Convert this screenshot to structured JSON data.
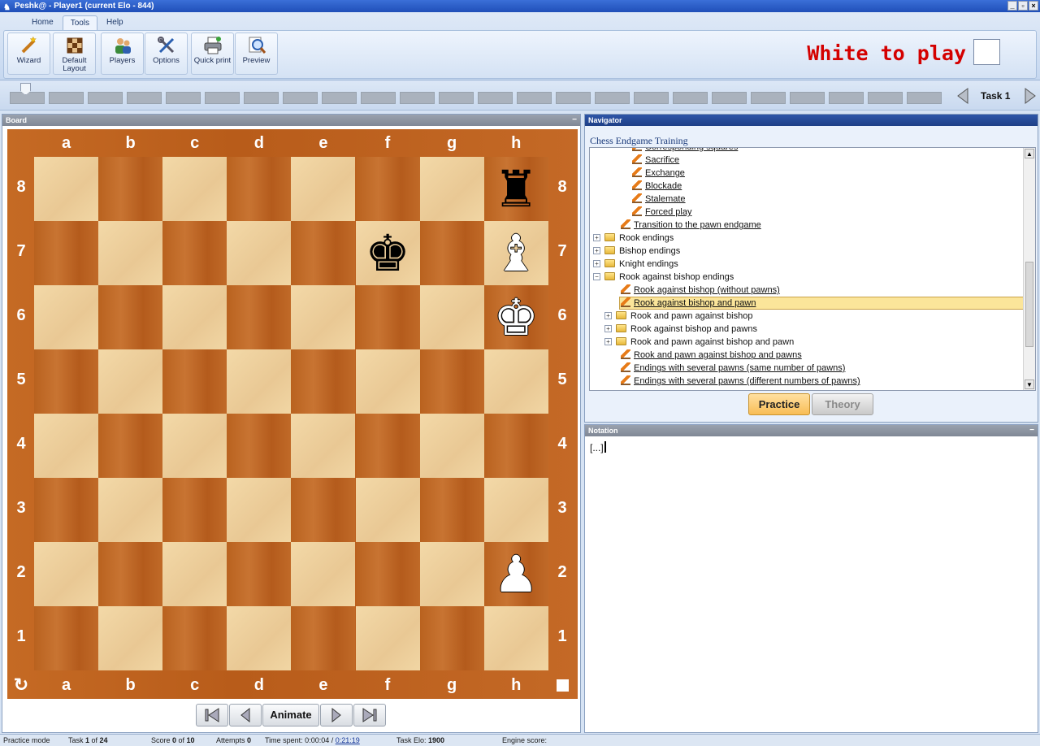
{
  "window": {
    "title": "Peshk@ - Player1 (current Elo - 844)"
  },
  "ribbon": {
    "tabs": [
      {
        "label": "Home"
      },
      {
        "label": "Tools"
      },
      {
        "label": "Help"
      }
    ],
    "buttons": {
      "wizard": "Wizard",
      "default_layout_1": "Default",
      "default_layout_2": "Layout",
      "players": "Players",
      "options": "Options",
      "quick_print": "Quick print",
      "preview": "Preview"
    },
    "turn_label": "White to play"
  },
  "task_strip": {
    "task_label": "Task  1"
  },
  "board": {
    "panel_title": "Board",
    "files": [
      "a",
      "b",
      "c",
      "d",
      "e",
      "f",
      "g",
      "h"
    ],
    "ranks": [
      "8",
      "7",
      "6",
      "5",
      "4",
      "3",
      "2",
      "1"
    ],
    "pieces": {
      "h8": "♜",
      "f7": "♚",
      "h7": "♝",
      "h6": "♚",
      "h2": "♟"
    },
    "flip_glyph": "↻",
    "animate_label": "Animate"
  },
  "navigator": {
    "panel_title": "Navigator",
    "course_title": "Chess Endgame Training",
    "items": [
      {
        "label": "Corresponding squares"
      },
      {
        "label": "Sacrifice"
      },
      {
        "label": "Exchange"
      },
      {
        "label": "Blockade"
      },
      {
        "label": "Stalemate"
      },
      {
        "label": "Forced play"
      },
      {
        "label": "Transition to the pawn endgame"
      },
      {
        "label": "Rook endings"
      },
      {
        "label": "Bishop endings"
      },
      {
        "label": "Knight endings"
      },
      {
        "label": "Rook against bishop endings"
      },
      {
        "label": "Rook against bishop (without pawns)"
      },
      {
        "label": "Rook against bishop and pawn"
      },
      {
        "label": "Rook and pawn against bishop"
      },
      {
        "label": "Rook against bishop and pawns"
      },
      {
        "label": "Rook and pawn against bishop and pawn"
      },
      {
        "label": "Rook and pawn against bishop and pawns"
      },
      {
        "label": "Endings with several pawns (same number of pawns)"
      },
      {
        "label": "Endings with several pawns (different numbers of pawns)"
      }
    ],
    "practice_label": "Practice",
    "theory_label": "Theory"
  },
  "notation": {
    "panel_title": "Notation",
    "text": "[...]"
  },
  "status": {
    "mode": "Practice mode",
    "task_prefix": "Task ",
    "task_num": "1",
    "task_mid": " of ",
    "task_total": "24",
    "score_prefix": "Score ",
    "score_num": "0",
    "score_mid": " of ",
    "score_total": "10",
    "attempts_prefix": "Attempts ",
    "attempts_num": "0",
    "time_prefix": "Time spent: 0:00:04 / ",
    "time_limit": "0:21:19",
    "elo_prefix": "Task Elo: ",
    "elo_value": "1900",
    "engine": "Engine score:"
  },
  "colors": {
    "accent_red": "#d40000",
    "board_dark": "#b9621f",
    "board_light": "#f3d9a8",
    "selection": "#fbe59a"
  }
}
